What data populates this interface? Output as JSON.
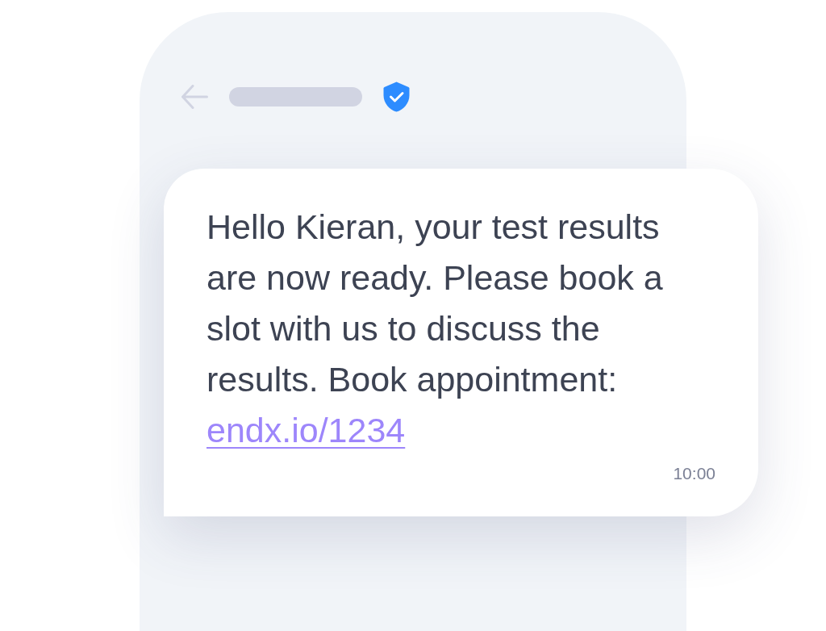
{
  "header": {
    "verified": true
  },
  "message": {
    "text": "Hello Kieran, your test results are now ready. Please book a slot with us to discuss the results. Book appointment:",
    "link": "endx.io/1234",
    "time": "10:00"
  }
}
